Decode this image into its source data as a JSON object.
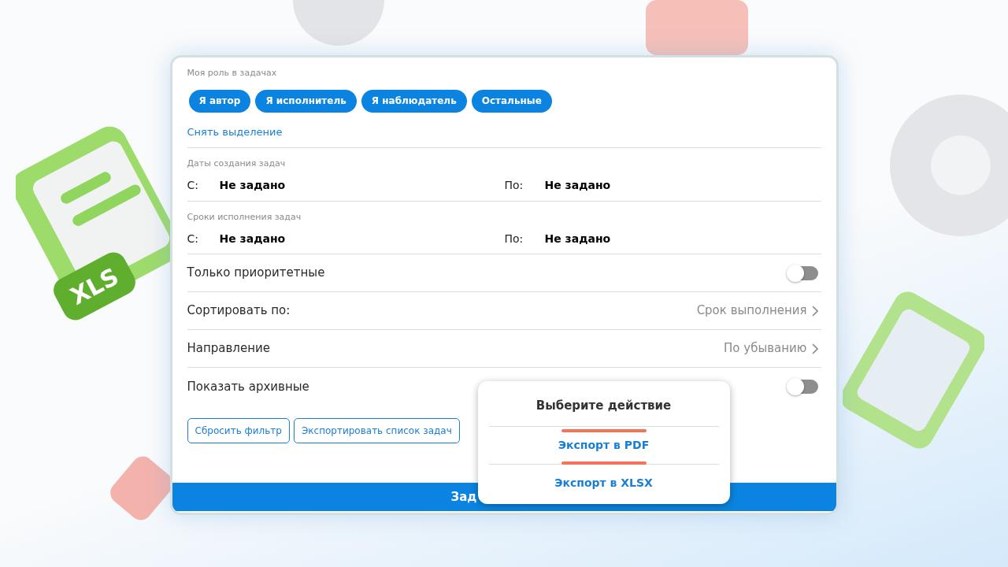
{
  "backdrop": {
    "badge": "XLS"
  },
  "role_filter": {
    "label": "Моя роль в задачах",
    "chips": [
      {
        "label": "Я автор",
        "selected": true
      },
      {
        "label": "Я исполнитель",
        "selected": true
      },
      {
        "label": "Я наблюдатель",
        "selected": true
      },
      {
        "label": "Остальные",
        "selected": true
      }
    ],
    "clear_link": "Снять выделение"
  },
  "date_groups": [
    {
      "label": "Даты создания задач",
      "from_label": "С:",
      "from_value": "Не задано",
      "to_label": "По:",
      "to_value": "Не задано"
    },
    {
      "label": "Сроки исполнения задач",
      "from_label": "С:",
      "from_value": "Не задано",
      "to_label": "По:",
      "to_value": "Не задано"
    }
  ],
  "settings": [
    {
      "kind": "toggle",
      "label": "Только приоритетные",
      "on": false
    },
    {
      "kind": "select",
      "label": "Сортировать по:",
      "value": "Срок выполнения"
    },
    {
      "kind": "select",
      "label": "Направление",
      "value": "По убыванию"
    },
    {
      "kind": "toggle",
      "label": "Показать архивные",
      "on": false
    }
  ],
  "buttons": [
    "Сбросить фильтр",
    "Экспортировать список задач"
  ],
  "bottom_bar": {
    "label": "Зад"
  },
  "action_sheet": {
    "title": "Выберите действие",
    "actions": [
      {
        "label": "Экспорт в PDF",
        "highlighted": true
      },
      {
        "label": "Экспорт в XLSX",
        "highlighted": false
      }
    ]
  }
}
